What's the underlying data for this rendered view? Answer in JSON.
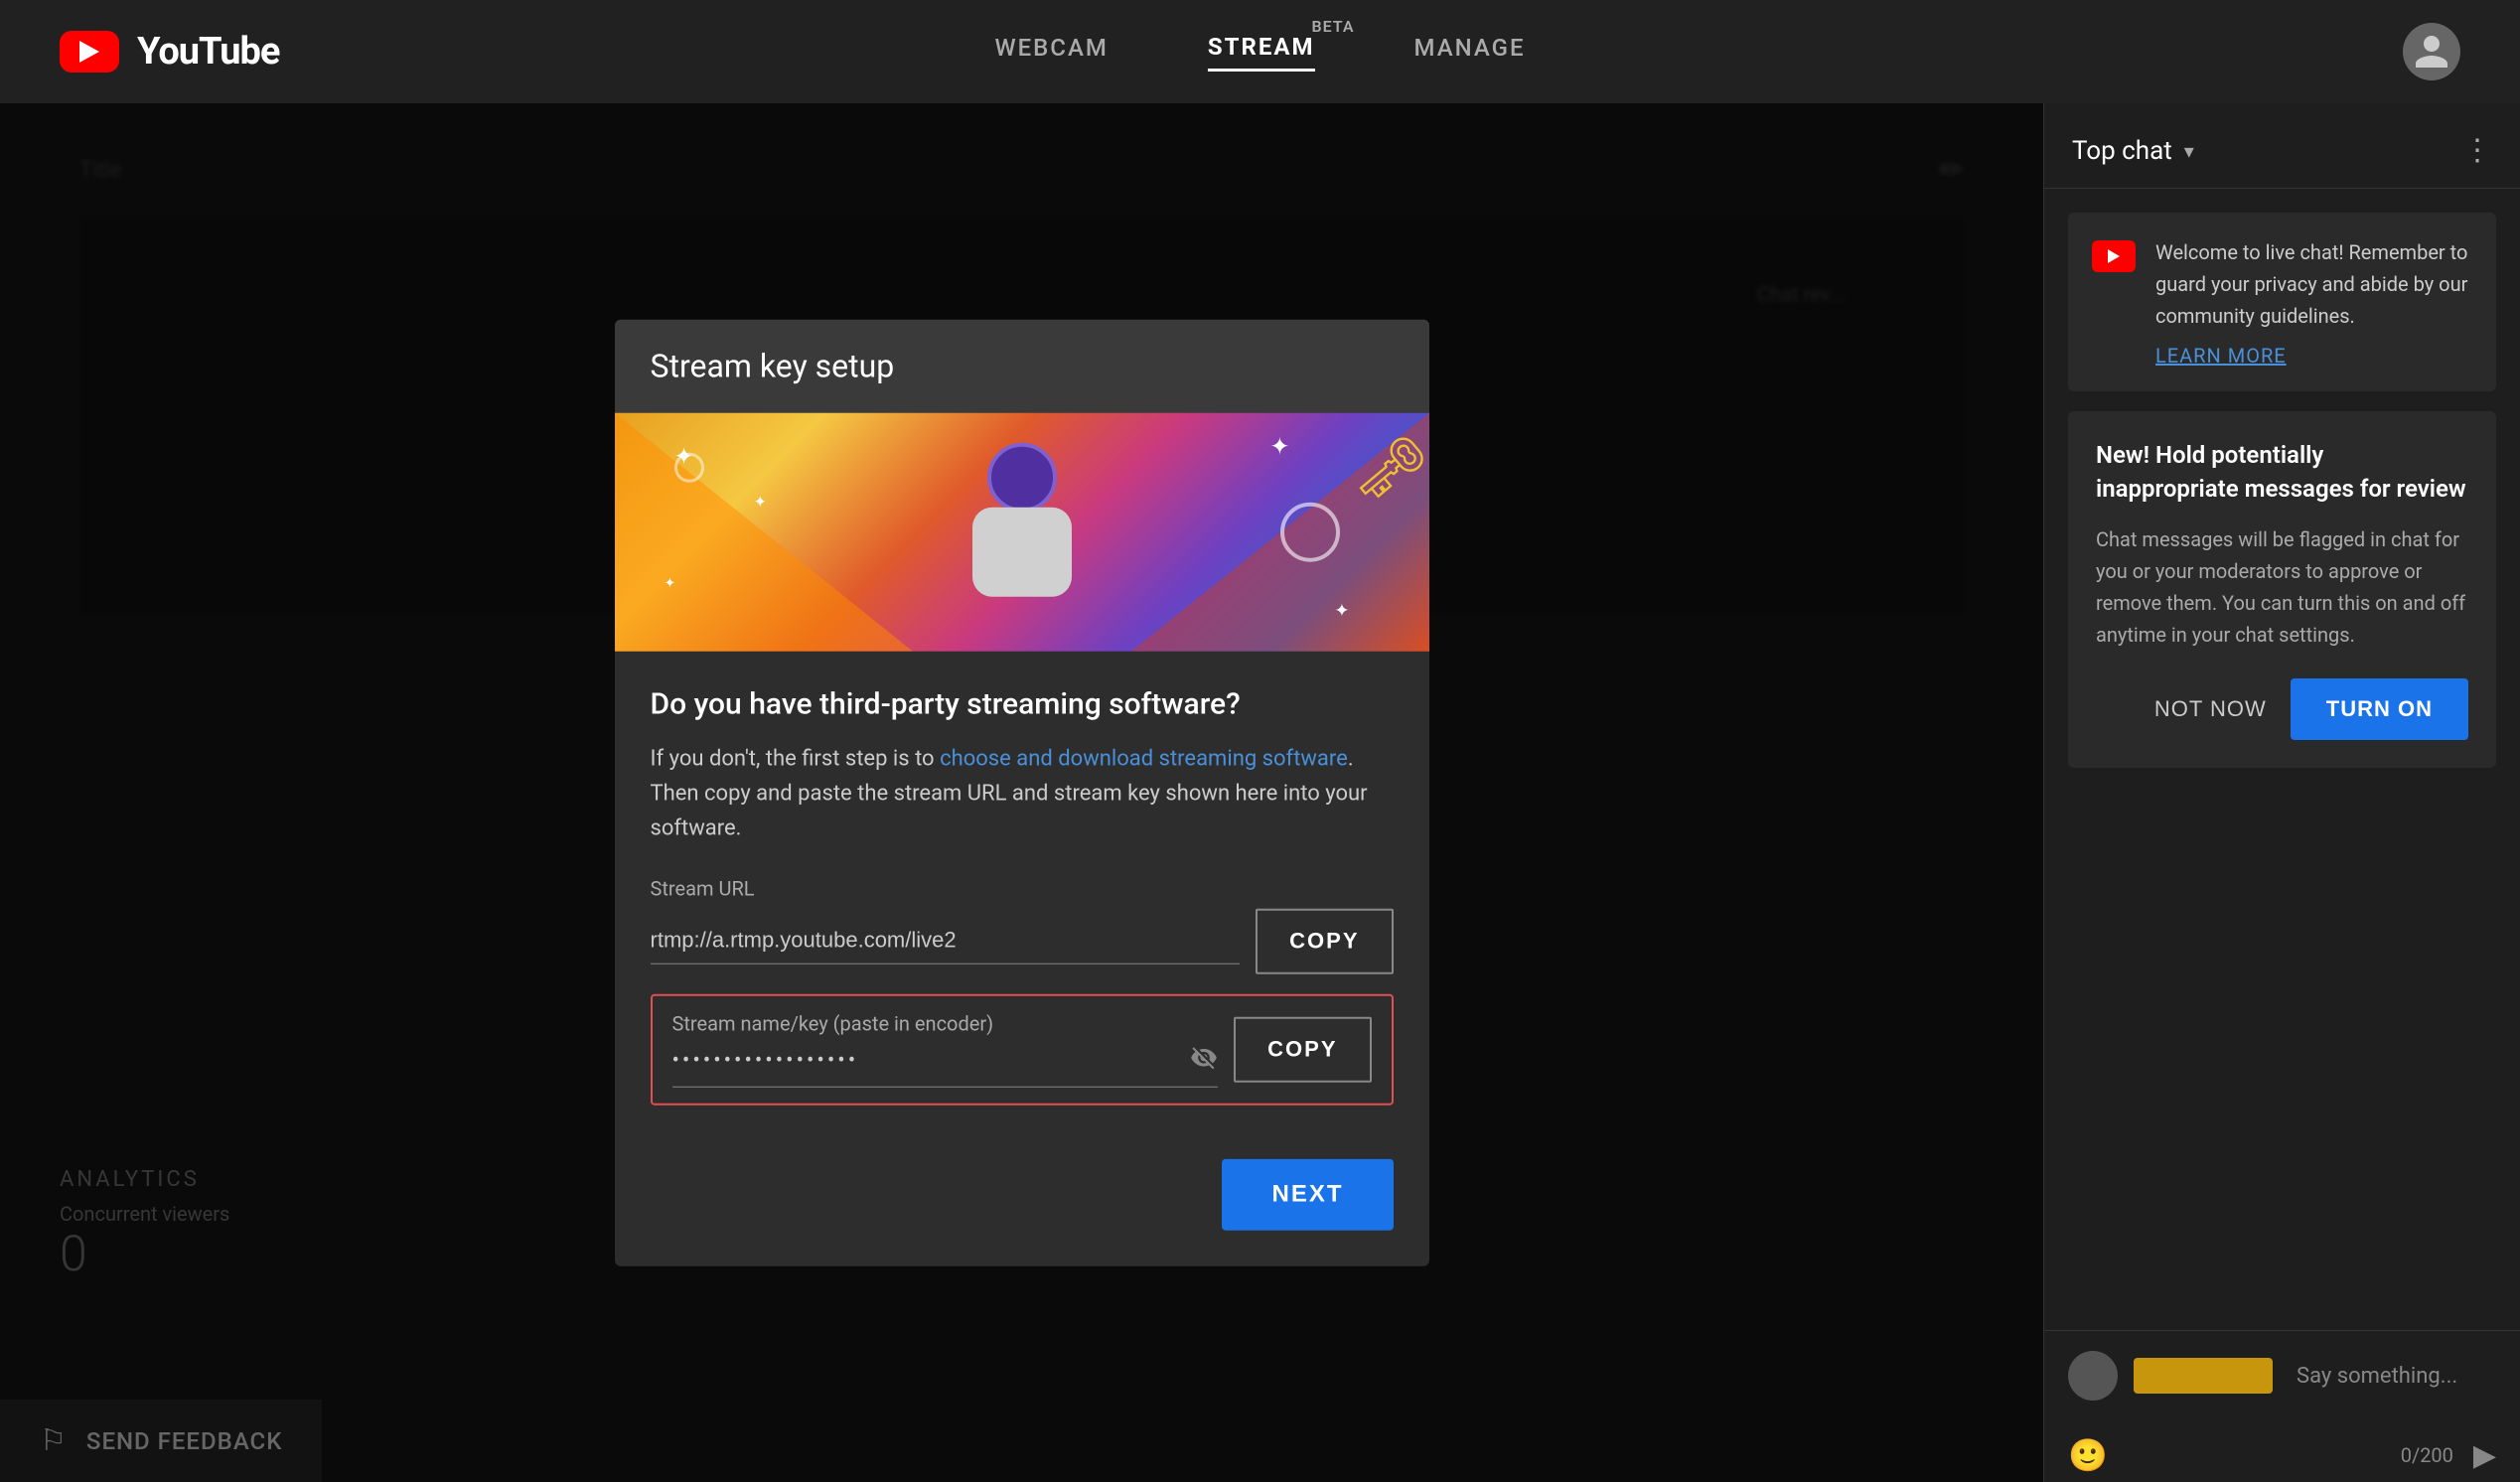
{
  "nav": {
    "logo_text": "YouTube",
    "tabs": [
      {
        "id": "webcam",
        "label": "WEBCAM",
        "active": false
      },
      {
        "id": "stream",
        "label": "STREAM",
        "active": true,
        "badge": "BETA"
      },
      {
        "id": "manage",
        "label": "MANAGE",
        "active": false
      }
    ]
  },
  "background": {
    "title_label": "Title",
    "chat_rev_label": "Chat rev...",
    "analytics_label": "ANALYTICS",
    "viewers_label": "Concurrent viewers",
    "viewers_value": "0"
  },
  "modal": {
    "title": "Stream key setup",
    "question": "Do you have third-party streaming software?",
    "description_before_link": "If you don't, the first step is to ",
    "link_text": "choose and download streaming software",
    "description_after_link": ". Then copy and paste the stream URL and stream key shown here into your software.",
    "stream_url_label": "Stream URL",
    "stream_url_value": "rtmp://a.rtmp.youtube.com/live2",
    "copy_url_label": "COPY",
    "stream_key_label": "Stream name/key (paste in encoder)",
    "stream_key_value": "••••••••••••••••••",
    "copy_key_label": "COPY",
    "next_label": "NEXT"
  },
  "chat": {
    "title": "Top chat",
    "welcome_text": "Welcome to live chat! Remember to guard your privacy and abide by our community guidelines.",
    "learn_more_label": "LEARN MORE",
    "hold_title": "New! Hold potentially inappropriate messages for review",
    "hold_desc": "Chat messages will be flagged in chat for you or your moderators to approve or remove them. You can turn this on and off anytime in your chat settings.",
    "not_now_label": "NOT NOW",
    "turn_on_label": "TURN ON",
    "input_placeholder": "Say something...",
    "char_count": "0/200"
  },
  "feedback": {
    "label": "SEND FEEDBACK"
  }
}
